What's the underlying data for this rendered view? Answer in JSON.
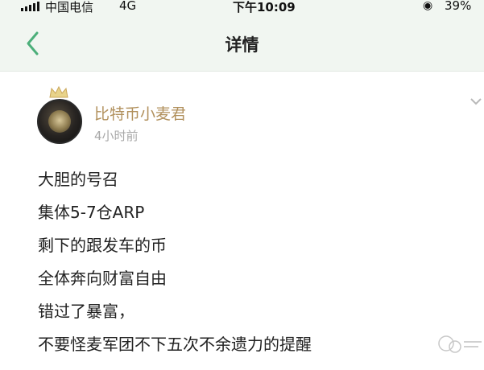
{
  "status_bar": {
    "carrier": "中国电信",
    "network": "4G",
    "time": "下午10:09",
    "battery": "39%"
  },
  "nav": {
    "title": "详情",
    "back_icon": "chevron-left-icon"
  },
  "post": {
    "author": "比特币小麦君",
    "time_ago": "4小时前",
    "lines": [
      "大胆的号召",
      "集体5-7仓ARP",
      "剩下的跟发车的币",
      "全体奔向财富自由",
      "错过了暴富，",
      "不要怪麦军团不下五次不余遗力的提醒"
    ]
  },
  "colors": {
    "accent": "#4caf7a",
    "author": "#b1905c",
    "muted": "#a8a8a8",
    "nav_bg": "#f1f6f1"
  }
}
